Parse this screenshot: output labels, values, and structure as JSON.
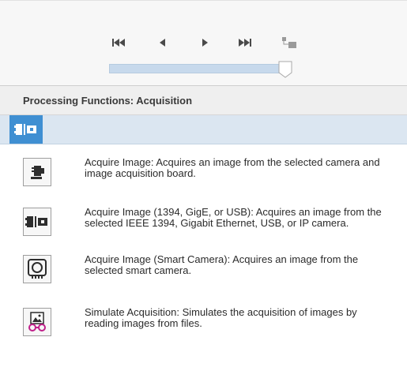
{
  "navigation": {
    "first_icon": "skip-to-first-icon",
    "previous_icon": "previous-icon",
    "next_icon": "next-icon",
    "last_icon": "skip-to-last-icon",
    "toggle_icon": "step-mode-icon"
  },
  "slider": {
    "position_fraction": 0.97
  },
  "section": {
    "title": "Processing Functions: Acquisition"
  },
  "toolbar": {
    "category_icon": "acquisition-category-icon"
  },
  "functions": [
    {
      "icon": "camera-board-icon",
      "description": "Acquire Image:  Acquires an image from the selected camera and image acquisition board."
    },
    {
      "icon": "ieee-camera-icon",
      "description": "Acquire Image (1394, GigE, or USB): Acquires an image from the selected IEEE 1394, Gigabit Ethernet, USB, or IP camera."
    },
    {
      "icon": "smart-camera-icon",
      "description": "Acquire Image (Smart Camera):  Acquires an image from the selected smart camera."
    },
    {
      "icon": "simulate-files-icon",
      "description": "Simulate Acquisition:  Simulates the acquisition of images by reading images from files."
    }
  ],
  "colors": {
    "accent": "#3f8fd2",
    "toolbar_bg": "#dbe6f1",
    "slider_fill": "#c7d9ec"
  }
}
